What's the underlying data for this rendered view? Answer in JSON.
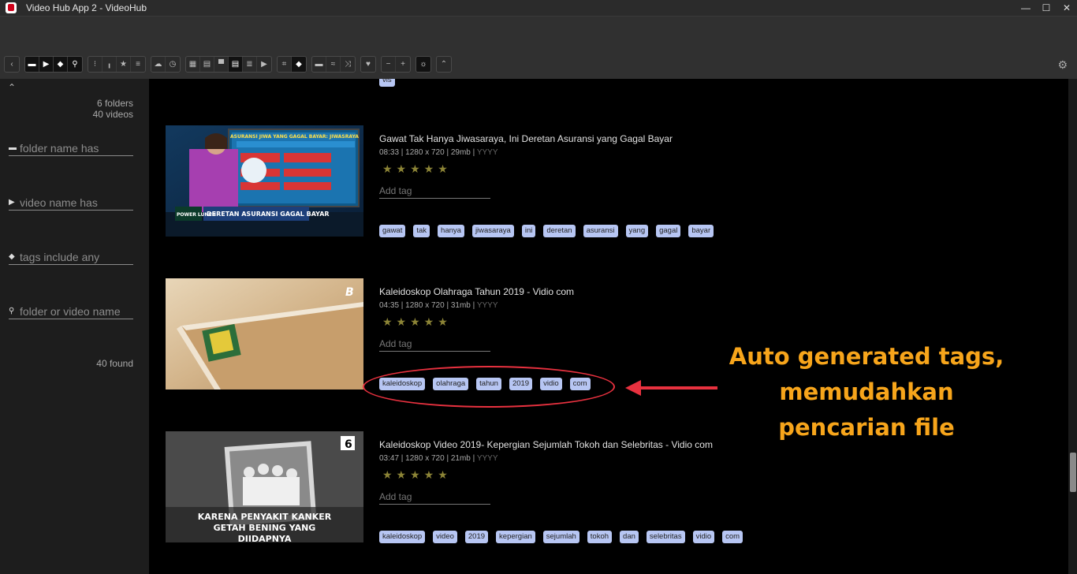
{
  "window": {
    "title": "Video Hub App 2 - VideoHub",
    "minimize": "—",
    "maximize": "☐",
    "close": "✕"
  },
  "sidebar": {
    "folders_count": "6 folders",
    "videos_count": "40 videos",
    "filters": [
      {
        "icon": "folder-icon",
        "placeholder": "folder name has"
      },
      {
        "icon": "play-icon",
        "placeholder": "video name has"
      },
      {
        "icon": "tag-icon",
        "placeholder": "tags include any"
      },
      {
        "icon": "search-icon",
        "placeholder": "folder or video name"
      }
    ],
    "found": "40 found"
  },
  "top_tag": "vis",
  "videos": [
    {
      "title": "Gawat Tak Hanya Jiwasaraya, Ini Deretan Asuransi yang Gagal Bayar",
      "meta": "08:33 | 1280 x 720 | 29mb |",
      "year": "YYYY",
      "stars": "★★★★★",
      "add_tag": "Add tag",
      "thumb_caption": "DERETAN ASURANSI GAGAL BAYAR",
      "thumb_banner": "ASURANSI JIWA YANG GAGAL BAYAR: JIWASRAYA",
      "thumb_logo": "POWER LUNCH",
      "tags": [
        "gawat",
        "tak",
        "hanya",
        "jiwasaraya",
        "ini",
        "deretan",
        "asuransi",
        "yang",
        "gagal",
        "bayar"
      ]
    },
    {
      "title": "Kaleidoskop Olahraga Tahun 2019 - Vidio com",
      "meta": "04:35 | 1280 x 720 | 31mb |",
      "year": "YYYY",
      "stars": "★★★★★",
      "add_tag": "Add tag",
      "thumb_logo": "B",
      "tags": [
        "kaleidoskop",
        "olahraga",
        "tahun",
        "2019",
        "vidio",
        "com"
      ]
    },
    {
      "title": "Kaleidoskop Video 2019- Kepergian Sejumlah Tokoh dan Selebritas - Vidio com",
      "meta": "03:47 | 1280 x 720 | 21mb |",
      "year": "YYYY",
      "stars": "★★★★★",
      "add_tag": "Add tag",
      "thumb_logo": "6",
      "thumb_caption": "KARENA PENYAKIT KANKER GETAH BENING YANG DIIDAPNYA",
      "tags": [
        "kaleidoskop",
        "video",
        "2019",
        "kepergian",
        "sejumlah",
        "tokoh",
        "dan",
        "selebritas",
        "vidio",
        "com"
      ]
    }
  ],
  "annotation": {
    "line1": "Auto generated tags,",
    "line2": "memudahkan",
    "line3": "pencarian file",
    "color": "#f7a51b",
    "highlight_color": "#e8313f"
  },
  "colors": {
    "tag_bg": "#b7c6f3",
    "sidebar_bg": "#1d1d1d",
    "header_bg": "#303030"
  }
}
